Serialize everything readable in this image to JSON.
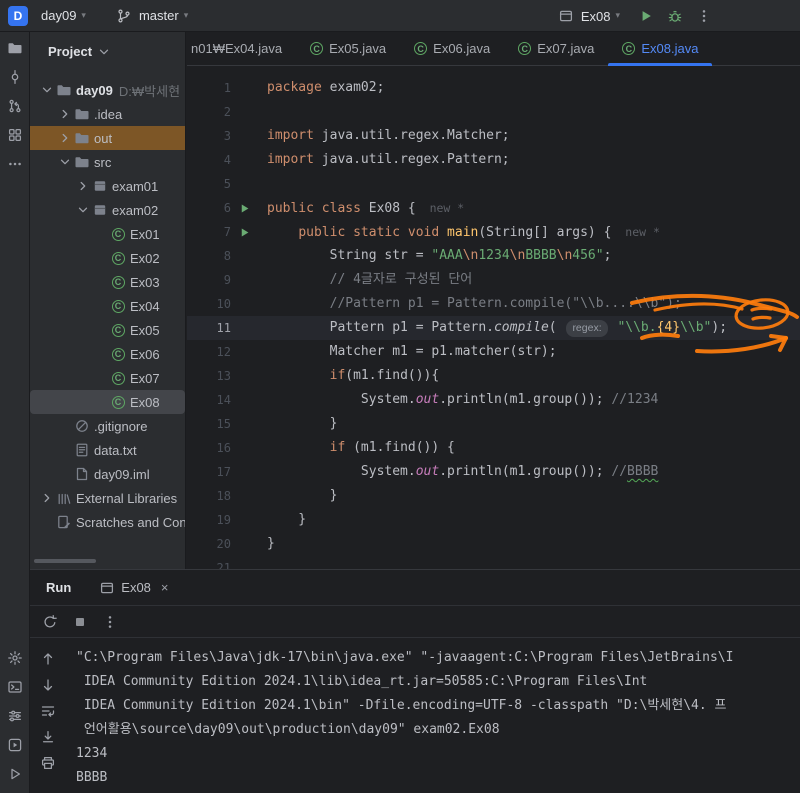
{
  "colors": {
    "accent_blue": "#3574f0",
    "run_green": "#6aab73",
    "excluded_row_highlight": "#7d5626",
    "selected_row": "#43454a"
  },
  "title_bar": {
    "logo": "D",
    "project_name": "day09",
    "branch_name": "master",
    "run_config": "Ex08"
  },
  "left_strip": {
    "top": [
      "project-folder",
      "commit",
      "pull-requests",
      "structure",
      "more-tools"
    ],
    "bottom": [
      "settings",
      "terminal",
      "run-configurations",
      "services",
      "run-tool"
    ]
  },
  "project_panel": {
    "header": "Project",
    "tree": [
      {
        "indent": 0,
        "chevron": "down",
        "icon": "folder",
        "label": "day09",
        "sublabel": "D:₩박세현",
        "bold": true
      },
      {
        "indent": 1,
        "chevron": "right",
        "icon": "folder",
        "label": ".idea"
      },
      {
        "indent": 1,
        "chevron": "right",
        "icon": "folder",
        "label": "out",
        "highlight": true
      },
      {
        "indent": 1,
        "chevron": "down",
        "icon": "folder",
        "label": "src"
      },
      {
        "indent": 2,
        "chevron": "right",
        "icon": "package",
        "label": "exam01"
      },
      {
        "indent": 2,
        "chevron": "down",
        "icon": "package",
        "label": "exam02"
      },
      {
        "indent": 3,
        "icon": "class",
        "label": "Ex01"
      },
      {
        "indent": 3,
        "icon": "class",
        "label": "Ex02"
      },
      {
        "indent": 3,
        "icon": "class",
        "label": "Ex03"
      },
      {
        "indent": 3,
        "icon": "class",
        "label": "Ex04"
      },
      {
        "indent": 3,
        "icon": "class",
        "label": "Ex05"
      },
      {
        "indent": 3,
        "icon": "class",
        "label": "Ex06"
      },
      {
        "indent": 3,
        "icon": "class",
        "label": "Ex07"
      },
      {
        "indent": 3,
        "icon": "class",
        "label": "Ex08",
        "selected": true
      },
      {
        "indent": 1,
        "icon": "ignored",
        "label": ".gitignore"
      },
      {
        "indent": 1,
        "icon": "text-file",
        "label": "data.txt"
      },
      {
        "indent": 1,
        "icon": "file",
        "label": "day09.iml"
      },
      {
        "indent": 0,
        "chevron": "right",
        "icon": "library",
        "label": "External Libraries"
      },
      {
        "indent": 0,
        "icon": "scratches",
        "label": "Scratches and Consoles"
      }
    ]
  },
  "editor_tabs": [
    {
      "label": "n01₩Ex04.java",
      "clipped": true
    },
    {
      "label": "Ex05.java",
      "icon": "class"
    },
    {
      "label": "Ex06.java",
      "icon": "class"
    },
    {
      "label": "Ex07.java",
      "icon": "class"
    },
    {
      "label": "Ex08.java",
      "icon": "class",
      "active": true
    }
  ],
  "editor": {
    "lines": [
      {
        "n": 1,
        "segs": [
          [
            "package",
            "kw"
          ],
          [
            " exam02;",
            "pl"
          ]
        ]
      },
      {
        "n": 2,
        "segs": []
      },
      {
        "n": 3,
        "segs": [
          [
            "import",
            "kw"
          ],
          [
            " java.util.regex.Matcher;",
            "pl"
          ]
        ]
      },
      {
        "n": 4,
        "segs": [
          [
            "import",
            "kw"
          ],
          [
            " java.util.regex.Pattern;",
            "pl"
          ]
        ]
      },
      {
        "n": 5,
        "segs": []
      },
      {
        "n": 6,
        "run": true,
        "segs": [
          [
            "public",
            "kw"
          ],
          [
            " ",
            "pl"
          ],
          [
            "class",
            "kw"
          ],
          [
            " Ex08 {",
            "pl"
          ],
          [
            "  new *",
            "hint"
          ]
        ]
      },
      {
        "n": 7,
        "run": true,
        "segs": [
          [
            "    ",
            "pl"
          ],
          [
            "public",
            "kw"
          ],
          [
            " ",
            "pl"
          ],
          [
            "static",
            "kw"
          ],
          [
            " ",
            "pl"
          ],
          [
            "void",
            "kw"
          ],
          [
            " ",
            "pl"
          ],
          [
            "main",
            "mth"
          ],
          [
            "(String[] args) {",
            "pl"
          ],
          [
            "  new *",
            "hint"
          ]
        ]
      },
      {
        "n": 8,
        "segs": [
          [
            "        String str = ",
            "pl"
          ],
          [
            "\"AAA",
            "str"
          ],
          [
            "\\n",
            "esc"
          ],
          [
            "1234",
            "str"
          ],
          [
            "\\n",
            "esc"
          ],
          [
            "BBBB",
            "str"
          ],
          [
            "\\n",
            "esc"
          ],
          [
            "456\"",
            "str"
          ],
          [
            ";",
            "pl"
          ]
        ]
      },
      {
        "n": 9,
        "segs": [
          [
            "        ",
            "pl"
          ],
          [
            "// 4글자로 구성된 단어",
            "com"
          ]
        ]
      },
      {
        "n": 10,
        "segs": [
          [
            "        ",
            "pl"
          ],
          [
            "//Pattern p1 = Pattern.compile(\"\\\\b....\\\\b\");",
            "com"
          ]
        ]
      },
      {
        "n": 11,
        "current": true,
        "segs": [
          [
            "        Pattern p1 = Pattern.",
            "pl"
          ],
          [
            "compile",
            "itl"
          ],
          [
            "( ",
            "pl"
          ],
          [
            "regex:",
            "chip"
          ],
          [
            " ",
            "pl"
          ],
          [
            "\"\\\\b.",
            "str"
          ],
          [
            "{4}",
            "rgx"
          ],
          [
            "\\\\b\"",
            "str"
          ],
          [
            ");",
            "pl"
          ]
        ]
      },
      {
        "n": 12,
        "segs": [
          [
            "        Matcher m1 = p1.matcher(str);",
            "pl"
          ]
        ]
      },
      {
        "n": 13,
        "segs": [
          [
            "        ",
            "pl"
          ],
          [
            "if",
            "kw"
          ],
          [
            "(m1.find()){",
            "pl"
          ]
        ]
      },
      {
        "n": 14,
        "segs": [
          [
            "            System.",
            "pl"
          ],
          [
            "out",
            "fld"
          ],
          [
            ".println(m1.group()); ",
            "pl"
          ],
          [
            "//1234",
            "com"
          ]
        ]
      },
      {
        "n": 15,
        "segs": [
          [
            "        }",
            "pl"
          ]
        ]
      },
      {
        "n": 16,
        "segs": [
          [
            "        ",
            "pl"
          ],
          [
            "if",
            "kw"
          ],
          [
            " (m1.find()) {",
            "pl"
          ]
        ]
      },
      {
        "n": 17,
        "segs": [
          [
            "            System.",
            "pl"
          ],
          [
            "out",
            "fld"
          ],
          [
            ".println(m1.group()); ",
            "pl"
          ],
          [
            "//",
            "com"
          ],
          [
            "BBBB",
            "com-typo"
          ]
        ]
      },
      {
        "n": 18,
        "segs": [
          [
            "        }",
            "pl"
          ]
        ]
      },
      {
        "n": 19,
        "segs": [
          [
            "    }",
            "pl"
          ]
        ]
      },
      {
        "n": 20,
        "segs": [
          [
            "}",
            "pl"
          ]
        ]
      },
      {
        "n": 21,
        "segs": []
      }
    ]
  },
  "run_panel": {
    "title": "Run",
    "tab_label": "Ex08",
    "tab_close": "×",
    "toolbar": [
      "rerun",
      "stop",
      "more-vertical"
    ],
    "gutter": [
      "arrow-up",
      "arrow-down",
      "soft-wrap",
      "scroll-end",
      "print"
    ],
    "console_lines": [
      "\"C:\\Program Files\\Java\\jdk-17\\bin\\java.exe\" \"-javaagent:C:\\Program Files\\JetBrains\\I",
      " IDEA Community Edition 2024.1\\lib\\idea_rt.jar=50585:C:\\Program Files\\Int",
      " IDEA Community Edition 2024.1\\bin\" -Dfile.encoding=UTF-8 -classpath \"D:\\박세현\\4. 프",
      " 언어활용\\source\\day09\\out\\production\\day09\" exam02.Ex08",
      "1234",
      "BBBB"
    ]
  },
  "annotation": {
    "color": "#ff7d0d"
  }
}
